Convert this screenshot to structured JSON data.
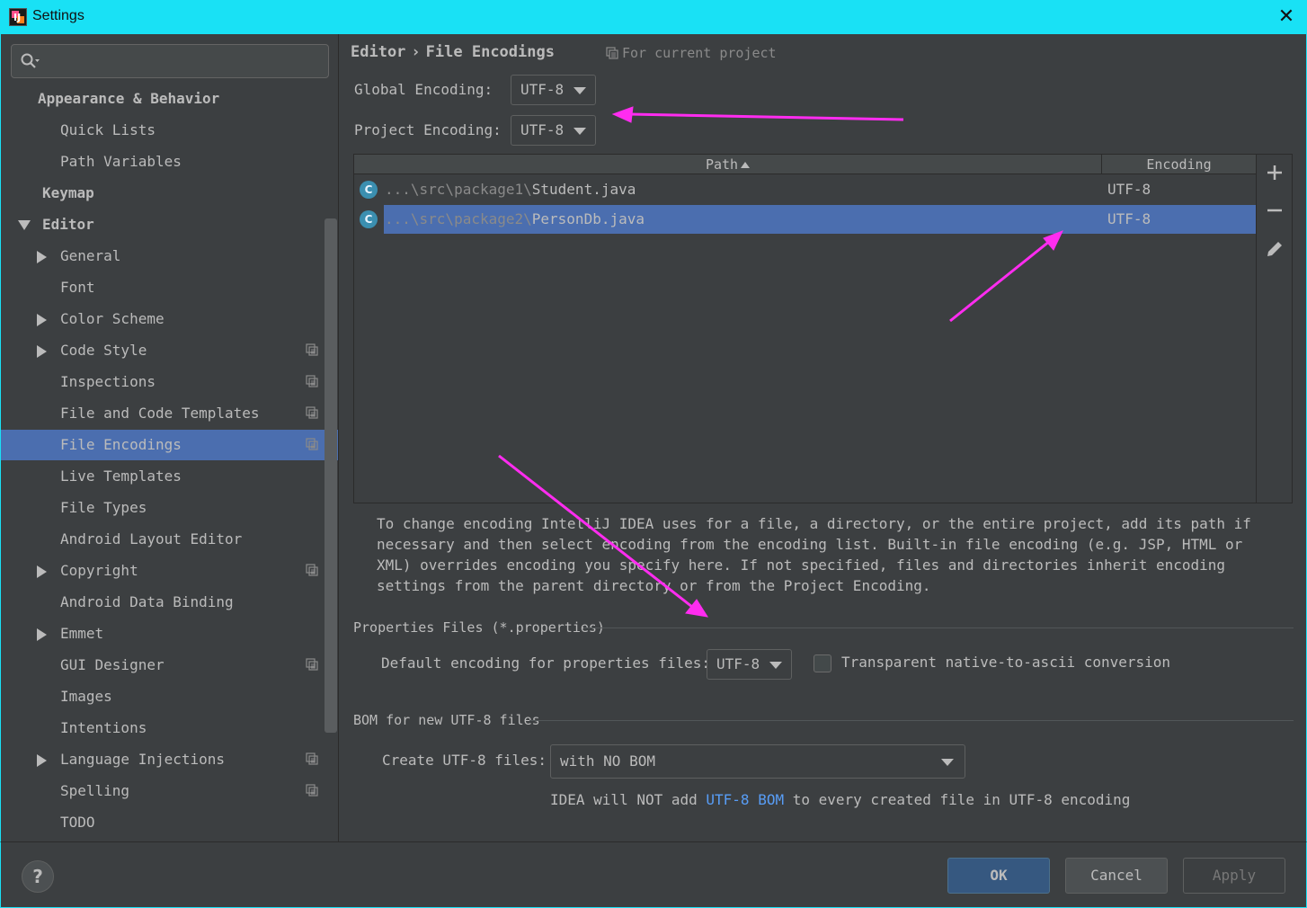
{
  "window": {
    "title": "Settings",
    "close_glyph": "✕"
  },
  "sidebar": {
    "search_placeholder": "",
    "items": [
      {
        "label": "Appearance & Behavior",
        "level": 0,
        "bold": true
      },
      {
        "label": "Quick Lists",
        "level": 1
      },
      {
        "label": "Path Variables",
        "level": 1
      },
      {
        "label": "Keymap",
        "level": 0,
        "bold": true
      },
      {
        "label": "Editor",
        "level": 0,
        "bold": true,
        "expanded": true
      },
      {
        "label": "General",
        "level": 1,
        "collapsed": true
      },
      {
        "label": "Font",
        "level": 1
      },
      {
        "label": "Color Scheme",
        "level": 1,
        "collapsed": true
      },
      {
        "label": "Code Style",
        "level": 1,
        "collapsed": true,
        "project": true
      },
      {
        "label": "Inspections",
        "level": 1,
        "project": true
      },
      {
        "label": "File and Code Templates",
        "level": 1,
        "project": true
      },
      {
        "label": "File Encodings",
        "level": 1,
        "project": true,
        "selected": true
      },
      {
        "label": "Live Templates",
        "level": 1
      },
      {
        "label": "File Types",
        "level": 1
      },
      {
        "label": "Android Layout Editor",
        "level": 1
      },
      {
        "label": "Copyright",
        "level": 1,
        "collapsed": true,
        "project": true
      },
      {
        "label": "Android Data Binding",
        "level": 1
      },
      {
        "label": "Emmet",
        "level": 1,
        "collapsed": true
      },
      {
        "label": "GUI Designer",
        "level": 1,
        "project": true
      },
      {
        "label": "Images",
        "level": 1
      },
      {
        "label": "Intentions",
        "level": 1
      },
      {
        "label": "Language Injections",
        "level": 1,
        "collapsed": true,
        "project": true
      },
      {
        "label": "Spelling",
        "level": 1,
        "project": true
      },
      {
        "label": "TODO",
        "level": 1
      }
    ]
  },
  "content": {
    "breadcrumb": {
      "parent": "Editor",
      "separator": "›",
      "current": "File Encodings"
    },
    "scope_label": "For current project",
    "global_encoding": {
      "label": "Global Encoding:",
      "value": "UTF-8"
    },
    "project_encoding": {
      "label": "Project Encoding:",
      "value": "UTF-8"
    },
    "table": {
      "columns": [
        "Path",
        "Encoding"
      ],
      "rows": [
        {
          "icon": "C",
          "path_prefix": "...\\src\\package1\\",
          "file": "Student.java",
          "encoding": "UTF-8",
          "selected": false
        },
        {
          "icon": "C",
          "path_prefix": "...\\src\\package2\\",
          "file": "PersonDb.java",
          "encoding": "UTF-8",
          "selected": true
        }
      ]
    },
    "help_text": "To change encoding IntelliJ IDEA uses for a file, a directory, or the entire project, add its path if necessary and then select encoding from the encoding list. Built-in file encoding (e.g. JSP, HTML or XML) overrides encoding you specify here. If not specified, files and directories inherit encoding settings from the parent directory or from the Project Encoding.",
    "properties": {
      "section_title": "Properties Files (*.properties)",
      "default_label": "Default encoding for properties files:",
      "default_value": "UTF-8",
      "transparent_label": "Transparent native-to-ascii conversion",
      "transparent_checked": false
    },
    "bom": {
      "section_title": "BOM for new UTF-8 files",
      "create_label": "Create UTF-8 files:",
      "create_value": "with NO BOM",
      "note_before": "IDEA will NOT add ",
      "note_link": "UTF-8 BOM",
      "note_after": " to every created file in UTF-8 encoding"
    }
  },
  "footer": {
    "help": "?",
    "ok": "OK",
    "cancel": "Cancel",
    "apply": "Apply"
  },
  "colors": {
    "accent": "#19e1f5",
    "selection": "#4b6eaf",
    "annotation": "#ff2cf0",
    "link": "#589df6"
  }
}
